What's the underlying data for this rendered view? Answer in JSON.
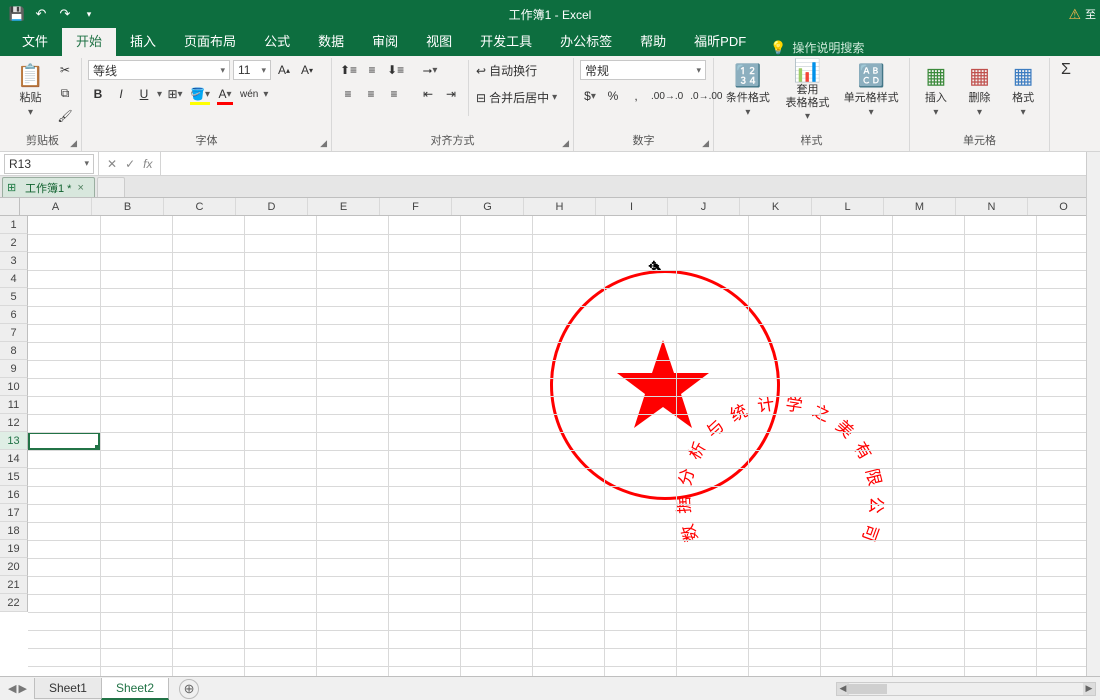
{
  "app": {
    "title": "工作簿1  -  Excel"
  },
  "qat": {
    "save": "save",
    "undo": "undo",
    "redo": "redo",
    "customize": "customize"
  },
  "tabs": {
    "file": "文件",
    "home": "开始",
    "insert": "插入",
    "layout": "页面布局",
    "formula": "公式",
    "data": "数据",
    "review": "审阅",
    "view": "视图",
    "dev": "开发工具",
    "office": "办公标签",
    "help": "帮助",
    "foxit": "福昕PDF",
    "tellme": "操作说明搜索"
  },
  "ribbon": {
    "clipboard": {
      "paste": "粘贴",
      "label": "剪贴板"
    },
    "font": {
      "name": "等线",
      "size": "11",
      "label": "字体",
      "bold": "B",
      "italic": "I",
      "underline": "U",
      "pinyin": "wén"
    },
    "align": {
      "label": "对齐方式",
      "wrap": "自动换行",
      "merge": "合并后居中"
    },
    "number": {
      "label": "数字",
      "format": "常规"
    },
    "styles": {
      "label": "样式",
      "cond": "条件格式",
      "table": "套用\n表格格式",
      "cell": "单元格样式"
    },
    "cells": {
      "label": "单元格",
      "insert": "插入",
      "delete": "删除",
      "format": "格式"
    }
  },
  "formula_bar": {
    "name": "R13",
    "fx": "fx",
    "value": ""
  },
  "workbook_tab": {
    "name": "工作簿1 *"
  },
  "grid": {
    "cols": [
      "A",
      "B",
      "C",
      "D",
      "E",
      "F",
      "G",
      "H",
      "I",
      "J",
      "K",
      "L",
      "M",
      "N",
      "O"
    ],
    "rows": [
      "1",
      "2",
      "3",
      "4",
      "5",
      "6",
      "7",
      "8",
      "9",
      "10",
      "11",
      "12",
      "13",
      "14",
      "15",
      "16",
      "17",
      "18",
      "19",
      "20",
      "21",
      "22"
    ],
    "selected": "R13"
  },
  "seal": {
    "text": "数据分析与统计学之美有限公司",
    "color": "#ff0000"
  },
  "sheets": {
    "s1": "Sheet1",
    "s2": "Sheet2"
  }
}
